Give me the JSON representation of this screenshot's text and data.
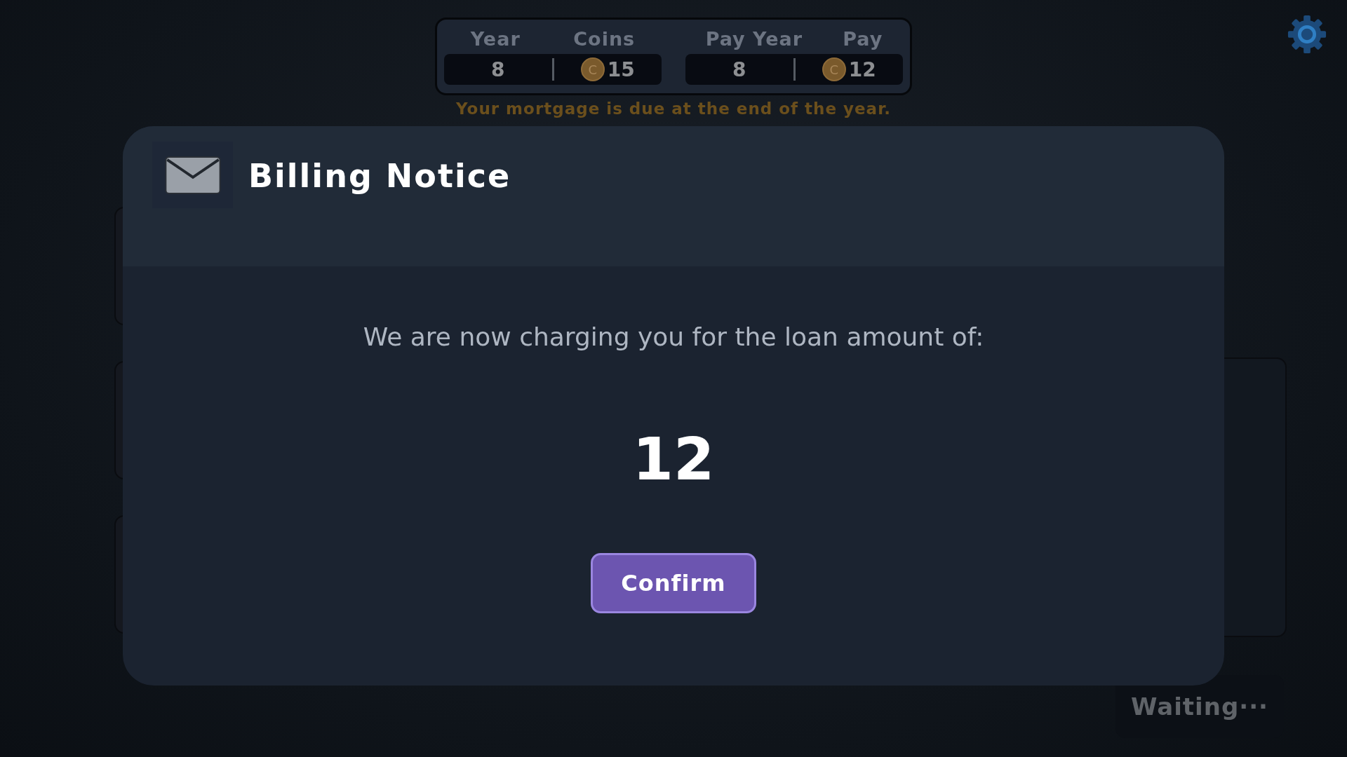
{
  "stats": [
    {
      "label": "Year",
      "value": "8"
    },
    {
      "label": "Coins",
      "value": "15",
      "coin_symbol": "C"
    },
    {
      "label": "Pay Year",
      "value": "8"
    },
    {
      "label": "Pay",
      "value": "12",
      "coin_symbol": "C"
    }
  ],
  "notice": "Your mortgage is due at the end of the year.",
  "dialog": {
    "title": "Billing Notice",
    "message": "We are now charging you for the loan amount of:",
    "amount": "12",
    "button": "Confirm"
  },
  "status_button": "Waiting···"
}
